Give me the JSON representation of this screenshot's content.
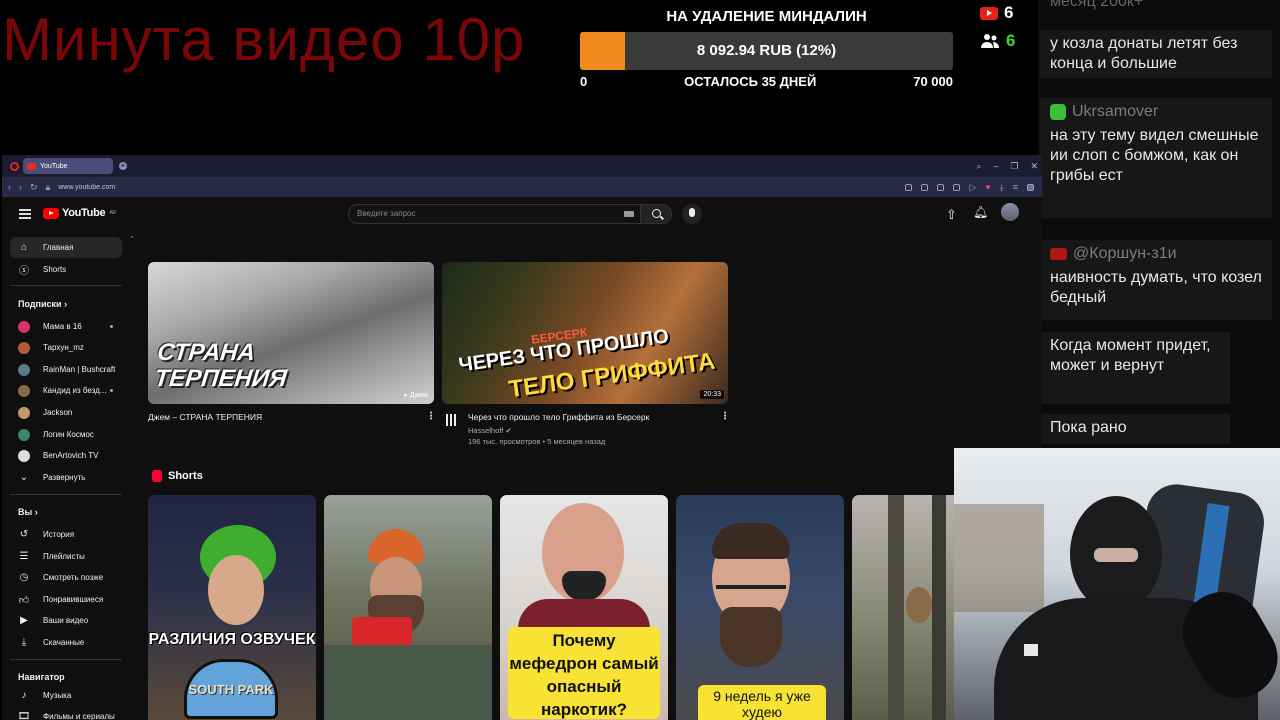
{
  "overlay": {
    "promo_text": "Минута видео 10р",
    "goal": {
      "title": "НА УДАЛЕНИЕ МИНДАЛИН",
      "amount_text": "8 092.94 RUB (12%)",
      "progress_percent": 12,
      "min_label": "0",
      "remaining_label": "ОСТАЛОСЬ 35 ДНЕЙ",
      "max_label": "70 000"
    },
    "counters": {
      "youtube_viewers": "6",
      "viewers": "6"
    }
  },
  "chat": {
    "messages": [
      {
        "author": "",
        "text": "у козла донаты летят без конца и большие"
      },
      {
        "author": "Ukrsamover",
        "text": "на эту тему видел смешные ии слоп с бомжом, как он грибы ест"
      },
      {
        "author": "@Коршун-з1и",
        "text": "наивность думать, что козел бедный"
      },
      {
        "author": "",
        "text": "Когда момент придет, может и вернут"
      },
      {
        "author": "",
        "text": "Пока рано"
      }
    ]
  },
  "browser": {
    "tab_title": "YouTube",
    "url": "www.youtube.com"
  },
  "youtube": {
    "logo_text": "YouTube",
    "logo_region": "AR",
    "search_placeholder": "Введите запрос",
    "sidebar": {
      "home": "Главная",
      "shorts": "Shorts",
      "subscriptions_header": "Подписки",
      "subscriptions": [
        "Мама в 16",
        "Тархун_mz",
        "RainMan | Bushcraft",
        "Кандид из безд...",
        "Jackson",
        "Логин Космос",
        "BenArtovich TV"
      ],
      "expand": "Развернуть",
      "you_header": "Вы",
      "you_items": [
        "История",
        "Плейлисты",
        "Смотреть позже",
        "Понравившиеся",
        "Ваши видео",
        "Скачанные"
      ],
      "navigator_header": "Навигатор",
      "navigator_items": [
        "Музыка",
        "Фильмы и сериалы"
      ]
    },
    "videos": [
      {
        "title": "Джем – СТРАНА ТЕРПЕНИЯ",
        "thumb_text": "СТРАНА ТЕРПЕНИЯ",
        "thumb_channel": "▸ Джем"
      },
      {
        "title": "Через что прошло тело Гриффита из Берсерк",
        "channel": "Hasselhoff",
        "meta": "196 тыс. просмотров • 5 месяцев назад",
        "duration": "20:33",
        "thumb_small": "БЕРСЕРК",
        "thumb_line1": "ЧЕРЕЗ ЧТО ПРОШЛО",
        "thumb_line2": "ТЕЛО ГРИФФИТА"
      }
    ],
    "shorts_header": "Shorts",
    "shorts": [
      {
        "caption": "РАЗЛИЧИЯ ОЗВУЧЕК",
        "logo_text": "SOUTH PARK"
      },
      {
        "caption": ""
      },
      {
        "caption": "Почему мефедрон самый опасный наркотик?"
      },
      {
        "caption": "9 недель я уже худею"
      },
      {
        "caption": ""
      }
    ]
  },
  "colors": {
    "promo": "#7a0608",
    "goal_fill": "#f18a1c",
    "youtube_red": "#ff0000",
    "viewer_green": "#3bd63b"
  }
}
